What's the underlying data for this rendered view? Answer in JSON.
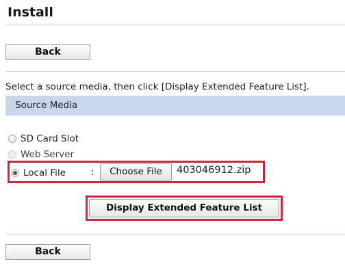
{
  "page": {
    "title": "Install"
  },
  "buttons": {
    "back_top": "Back",
    "back_bottom": "Back",
    "display_list": "Display Extended Feature List"
  },
  "instructions": "Select a source media, then click [Display Extended Feature List].",
  "section": {
    "title": "Source Media"
  },
  "source_options": [
    {
      "label": "SD Card Slot",
      "checked": false,
      "enabled": true
    },
    {
      "label": "Web Server",
      "checked": false,
      "enabled": false
    },
    {
      "label": "Local File",
      "checked": true,
      "enabled": true
    }
  ],
  "file_input": {
    "separator": ":",
    "button_label": "Choose File",
    "file_name": "403046912.zip"
  },
  "colors": {
    "section_bar": "#c7d6ea",
    "highlight": "#c8283a"
  }
}
